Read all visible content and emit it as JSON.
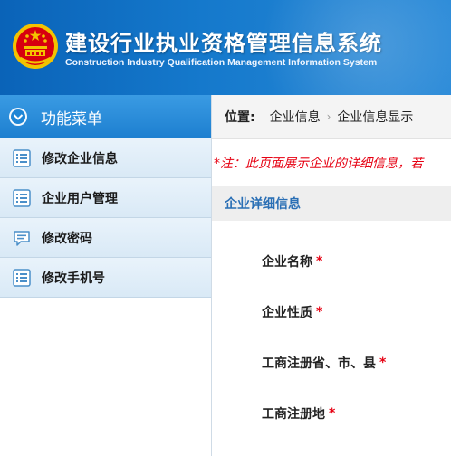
{
  "header": {
    "title": "建设行业执业资格管理信息系统",
    "subtitle": "Construction Industry Qualification Management Information System"
  },
  "sidebar": {
    "menu_title": "功能菜单",
    "items": [
      {
        "label": "修改企业信息",
        "icon": "list-icon"
      },
      {
        "label": "企业用户管理",
        "icon": "list-icon"
      },
      {
        "label": "修改密码",
        "icon": "message-icon"
      },
      {
        "label": "修改手机号",
        "icon": "list-icon"
      }
    ]
  },
  "breadcrumb": {
    "label": "位置:",
    "items": [
      "企业信息",
      "企业信息显示"
    ],
    "separator": "›"
  },
  "notice": "*注：此页面展示企业的详细信息，若",
  "section_title": "企业详细信息",
  "fields": [
    {
      "label": "企业名称",
      "required_mark": "*"
    },
    {
      "label": "企业性质",
      "required_mark": "*"
    },
    {
      "label": "工商注册省、市、县",
      "required_mark": "*"
    },
    {
      "label": "工商注册地",
      "required_mark": "*"
    }
  ],
  "colors": {
    "header_blue": "#1579cc",
    "menu_blue": "#1d7fd0",
    "required_red": "#e60012",
    "section_title_blue": "#2a6fb5"
  }
}
